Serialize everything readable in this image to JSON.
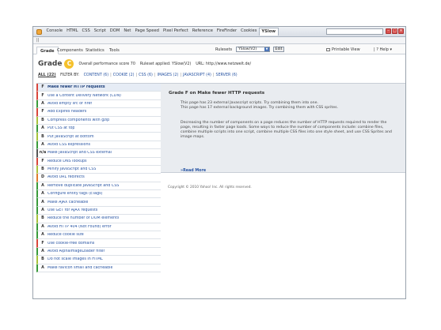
{
  "firebug": {
    "tabs": [
      "Console",
      "HTML",
      "CSS",
      "Script",
      "DOM",
      "Net",
      "Page Speed",
      "Pixel Perfect",
      "Reference",
      "FireFinder",
      "Cookies",
      "YSlow"
    ],
    "active_tab": "YSlow",
    "pause_icon": "||"
  },
  "yslow_nav": {
    "tabs": [
      "Grade",
      "Components",
      "Statistics",
      "Tools"
    ],
    "ruleset_label": "Rulesets",
    "ruleset_value": "YSlow(V2)",
    "edit_label": "Edit",
    "printable_label": "Printable View",
    "help_label": "Help ▾"
  },
  "grade": {
    "word": "Grade",
    "letter": "C",
    "overall_score": "Overall performance score 70",
    "ruleset_applied": "Ruleset applied: YSlow(V2)",
    "url": "URL: http://www.netzwelt.de/"
  },
  "filter": {
    "all": "ALL (22)",
    "label": "FILTER BY:",
    "items": [
      "CONTENT (6)",
      "COOKIE (2)",
      "CSS (6)",
      "IMAGES (2)",
      "JAVASCRIPT (4)",
      "SERVER (6)"
    ]
  },
  "rules": [
    {
      "grade": "F",
      "label": "Make fewer HTTP requests"
    },
    {
      "grade": "F",
      "label": "Use a Content Delivery Network (CDN)"
    },
    {
      "grade": "A",
      "label": "Avoid empty src or href"
    },
    {
      "grade": "F",
      "label": "Add Expires headers"
    },
    {
      "grade": "B",
      "label": "Compress components with gzip"
    },
    {
      "grade": "A",
      "label": "Put CSS at top"
    },
    {
      "grade": "B",
      "label": "Put JavaScript at bottom"
    },
    {
      "grade": "A",
      "label": "Avoid CSS expressions"
    },
    {
      "grade": "n/a",
      "label": "Make JavaScript and CSS external"
    },
    {
      "grade": "F",
      "label": "Reduce DNS lookups"
    },
    {
      "grade": "B",
      "label": "Minify JavaScript and CSS"
    },
    {
      "grade": "D",
      "label": "Avoid URL redirects"
    },
    {
      "grade": "A",
      "label": "Remove duplicate JavaScript and CSS"
    },
    {
      "grade": "A",
      "label": "Configure entity tags (ETags)"
    },
    {
      "grade": "A",
      "label": "Make AJAX cacheable"
    },
    {
      "grade": "A",
      "label": "Use GET for AJAX requests"
    },
    {
      "grade": "B",
      "label": "Reduce the number of DOM elements"
    },
    {
      "grade": "A",
      "label": "Avoid HTTP 404 (Not Found) error"
    },
    {
      "grade": "A",
      "label": "Reduce cookie size"
    },
    {
      "grade": "F",
      "label": "Use cookie-free domains"
    },
    {
      "grade": "A",
      "label": "Avoid AlphaImageLoader filter"
    },
    {
      "grade": "B",
      "label": "Do not scale images in HTML"
    },
    {
      "grade": "A",
      "label": "Make favicon small and cacheable"
    }
  ],
  "detail": {
    "title": "Grade F on Make fewer HTTP requests",
    "line1": "This page has 23 external Javascript scripts. Try combining them into one.",
    "line2": "This page has 17 external background images. Try combining them with CSS sprites.",
    "paragraph": "Decreasing the number of components on a page reduces the number of HTTP requests required to render the page, resulting in faster page loads. Some ways to reduce the number of components include: combine files, combine multiple scripts into one script, combine multiple CSS files into one style sheet, and use CSS Sprites and image maps.",
    "read_more": "»Read More"
  },
  "copyright": "Copyright © 2010 Yahoo! Inc. All rights reserved."
}
